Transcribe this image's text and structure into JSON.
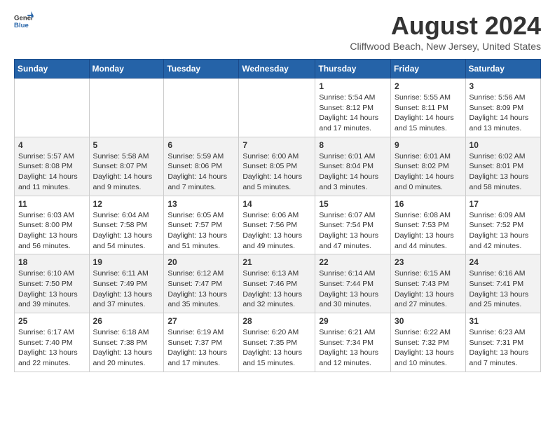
{
  "logo": {
    "line1": "General",
    "line2": "Blue"
  },
  "title": "August 2024",
  "subtitle": "Cliffwood Beach, New Jersey, United States",
  "weekdays": [
    "Sunday",
    "Monday",
    "Tuesday",
    "Wednesday",
    "Thursday",
    "Friday",
    "Saturday"
  ],
  "weeks": [
    [
      {
        "day": "",
        "info": ""
      },
      {
        "day": "",
        "info": ""
      },
      {
        "day": "",
        "info": ""
      },
      {
        "day": "",
        "info": ""
      },
      {
        "day": "1",
        "info": "Sunrise: 5:54 AM\nSunset: 8:12 PM\nDaylight: 14 hours\nand 17 minutes."
      },
      {
        "day": "2",
        "info": "Sunrise: 5:55 AM\nSunset: 8:11 PM\nDaylight: 14 hours\nand 15 minutes."
      },
      {
        "day": "3",
        "info": "Sunrise: 5:56 AM\nSunset: 8:09 PM\nDaylight: 14 hours\nand 13 minutes."
      }
    ],
    [
      {
        "day": "4",
        "info": "Sunrise: 5:57 AM\nSunset: 8:08 PM\nDaylight: 14 hours\nand 11 minutes."
      },
      {
        "day": "5",
        "info": "Sunrise: 5:58 AM\nSunset: 8:07 PM\nDaylight: 14 hours\nand 9 minutes."
      },
      {
        "day": "6",
        "info": "Sunrise: 5:59 AM\nSunset: 8:06 PM\nDaylight: 14 hours\nand 7 minutes."
      },
      {
        "day": "7",
        "info": "Sunrise: 6:00 AM\nSunset: 8:05 PM\nDaylight: 14 hours\nand 5 minutes."
      },
      {
        "day": "8",
        "info": "Sunrise: 6:01 AM\nSunset: 8:04 PM\nDaylight: 14 hours\nand 3 minutes."
      },
      {
        "day": "9",
        "info": "Sunrise: 6:01 AM\nSunset: 8:02 PM\nDaylight: 14 hours\nand 0 minutes."
      },
      {
        "day": "10",
        "info": "Sunrise: 6:02 AM\nSunset: 8:01 PM\nDaylight: 13 hours\nand 58 minutes."
      }
    ],
    [
      {
        "day": "11",
        "info": "Sunrise: 6:03 AM\nSunset: 8:00 PM\nDaylight: 13 hours\nand 56 minutes."
      },
      {
        "day": "12",
        "info": "Sunrise: 6:04 AM\nSunset: 7:58 PM\nDaylight: 13 hours\nand 54 minutes."
      },
      {
        "day": "13",
        "info": "Sunrise: 6:05 AM\nSunset: 7:57 PM\nDaylight: 13 hours\nand 51 minutes."
      },
      {
        "day": "14",
        "info": "Sunrise: 6:06 AM\nSunset: 7:56 PM\nDaylight: 13 hours\nand 49 minutes."
      },
      {
        "day": "15",
        "info": "Sunrise: 6:07 AM\nSunset: 7:54 PM\nDaylight: 13 hours\nand 47 minutes."
      },
      {
        "day": "16",
        "info": "Sunrise: 6:08 AM\nSunset: 7:53 PM\nDaylight: 13 hours\nand 44 minutes."
      },
      {
        "day": "17",
        "info": "Sunrise: 6:09 AM\nSunset: 7:52 PM\nDaylight: 13 hours\nand 42 minutes."
      }
    ],
    [
      {
        "day": "18",
        "info": "Sunrise: 6:10 AM\nSunset: 7:50 PM\nDaylight: 13 hours\nand 39 minutes."
      },
      {
        "day": "19",
        "info": "Sunrise: 6:11 AM\nSunset: 7:49 PM\nDaylight: 13 hours\nand 37 minutes."
      },
      {
        "day": "20",
        "info": "Sunrise: 6:12 AM\nSunset: 7:47 PM\nDaylight: 13 hours\nand 35 minutes."
      },
      {
        "day": "21",
        "info": "Sunrise: 6:13 AM\nSunset: 7:46 PM\nDaylight: 13 hours\nand 32 minutes."
      },
      {
        "day": "22",
        "info": "Sunrise: 6:14 AM\nSunset: 7:44 PM\nDaylight: 13 hours\nand 30 minutes."
      },
      {
        "day": "23",
        "info": "Sunrise: 6:15 AM\nSunset: 7:43 PM\nDaylight: 13 hours\nand 27 minutes."
      },
      {
        "day": "24",
        "info": "Sunrise: 6:16 AM\nSunset: 7:41 PM\nDaylight: 13 hours\nand 25 minutes."
      }
    ],
    [
      {
        "day": "25",
        "info": "Sunrise: 6:17 AM\nSunset: 7:40 PM\nDaylight: 13 hours\nand 22 minutes."
      },
      {
        "day": "26",
        "info": "Sunrise: 6:18 AM\nSunset: 7:38 PM\nDaylight: 13 hours\nand 20 minutes."
      },
      {
        "day": "27",
        "info": "Sunrise: 6:19 AM\nSunset: 7:37 PM\nDaylight: 13 hours\nand 17 minutes."
      },
      {
        "day": "28",
        "info": "Sunrise: 6:20 AM\nSunset: 7:35 PM\nDaylight: 13 hours\nand 15 minutes."
      },
      {
        "day": "29",
        "info": "Sunrise: 6:21 AM\nSunset: 7:34 PM\nDaylight: 13 hours\nand 12 minutes."
      },
      {
        "day": "30",
        "info": "Sunrise: 6:22 AM\nSunset: 7:32 PM\nDaylight: 13 hours\nand 10 minutes."
      },
      {
        "day": "31",
        "info": "Sunrise: 6:23 AM\nSunset: 7:31 PM\nDaylight: 13 hours\nand 7 minutes."
      }
    ]
  ]
}
